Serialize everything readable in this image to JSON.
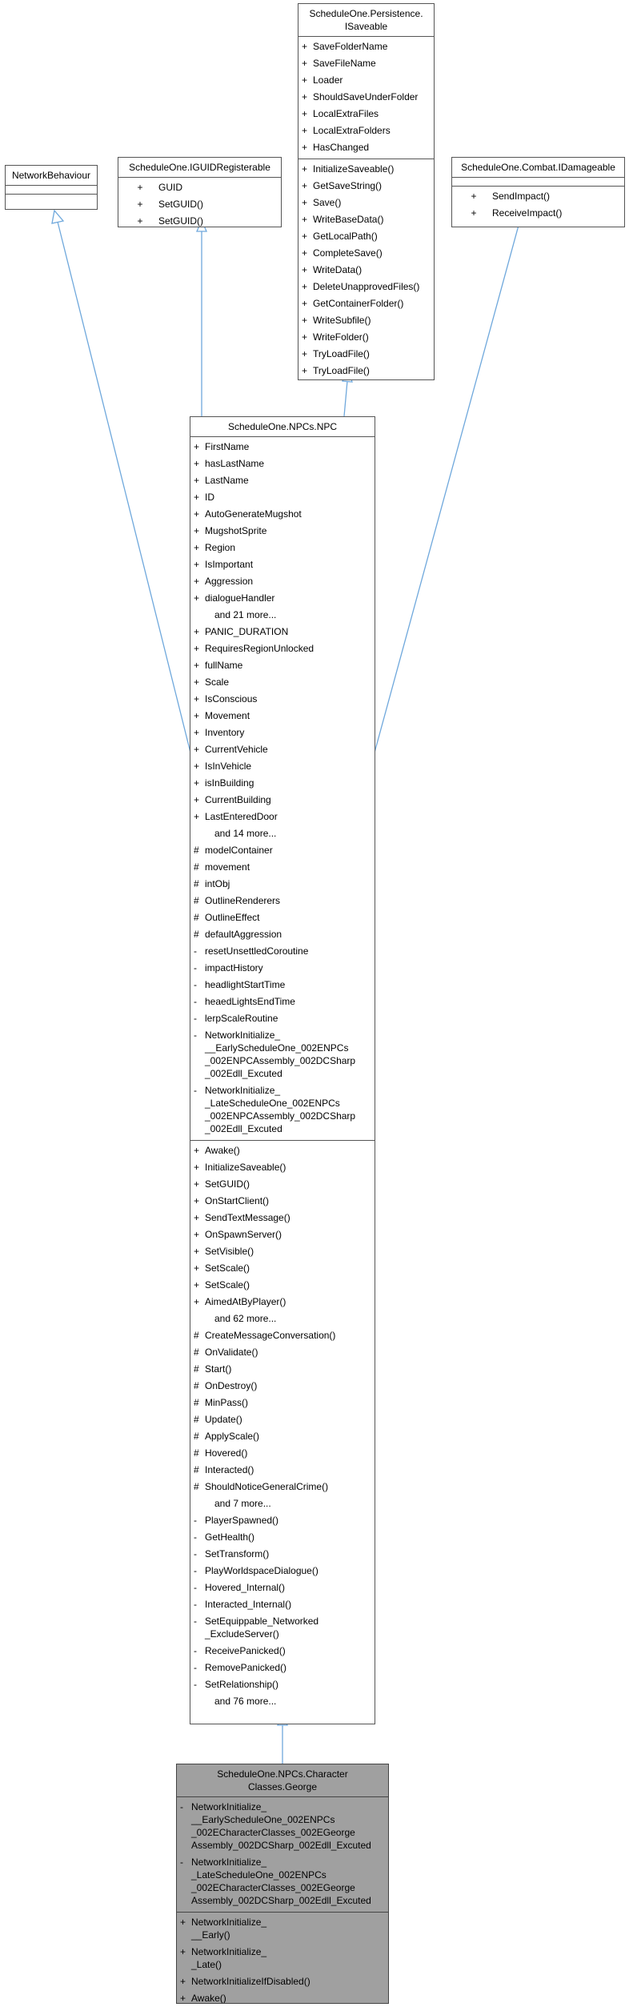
{
  "classes": {
    "network_behaviour": {
      "title": "NetworkBehaviour"
    },
    "iguid": {
      "title": "ScheduleOne.IGUIDRegisterable",
      "members": [
        {
          "v": "+",
          "n": "GUID"
        },
        {
          "v": "+",
          "n": "SetGUID()"
        },
        {
          "v": "+",
          "n": "SetGUID()"
        }
      ]
    },
    "isaveable": {
      "title": "ScheduleOne.Persistence.\nISaveable",
      "attrs": [
        {
          "v": "+",
          "n": "SaveFolderName"
        },
        {
          "v": "+",
          "n": "SaveFileName"
        },
        {
          "v": "+",
          "n": "Loader"
        },
        {
          "v": "+",
          "n": "ShouldSaveUnderFolder"
        },
        {
          "v": "+",
          "n": "LocalExtraFiles"
        },
        {
          "v": "+",
          "n": "LocalExtraFolders"
        },
        {
          "v": "+",
          "n": "HasChanged"
        }
      ],
      "methods": [
        {
          "v": "+",
          "n": "InitializeSaveable()"
        },
        {
          "v": "+",
          "n": "GetSaveString()"
        },
        {
          "v": "+",
          "n": "Save()"
        },
        {
          "v": "+",
          "n": "WriteBaseData()"
        },
        {
          "v": "+",
          "n": "GetLocalPath()"
        },
        {
          "v": "+",
          "n": "CompleteSave()"
        },
        {
          "v": "+",
          "n": "WriteData()"
        },
        {
          "v": "+",
          "n": "DeleteUnapprovedFiles()"
        },
        {
          "v": "+",
          "n": "GetContainerFolder()"
        },
        {
          "v": "+",
          "n": "WriteSubfile()"
        },
        {
          "v": "+",
          "n": "WriteFolder()"
        },
        {
          "v": "+",
          "n": "TryLoadFile()"
        },
        {
          "v": "+",
          "n": "TryLoadFile()"
        }
      ]
    },
    "idamageable": {
      "title": "ScheduleOne.Combat.IDamageable",
      "members": [
        {
          "v": "+",
          "n": "SendImpact()"
        },
        {
          "v": "+",
          "n": "ReceiveImpact()"
        }
      ]
    },
    "npc": {
      "title": "ScheduleOne.NPCs.NPC",
      "attrs": [
        {
          "v": "+",
          "n": "FirstName"
        },
        {
          "v": "+",
          "n": "hasLastName"
        },
        {
          "v": "+",
          "n": "LastName"
        },
        {
          "v": "+",
          "n": "ID"
        },
        {
          "v": "+",
          "n": "AutoGenerateMugshot"
        },
        {
          "v": "+",
          "n": "MugshotSprite"
        },
        {
          "v": "+",
          "n": "Region"
        },
        {
          "v": "+",
          "n": "IsImportant"
        },
        {
          "v": "+",
          "n": "Aggression"
        },
        {
          "v": "+",
          "n": "dialogueHandler"
        },
        {
          "v": "",
          "n": "and 21 more...",
          "more": true
        },
        {
          "v": "+",
          "n": "PANIC_DURATION"
        },
        {
          "v": "+",
          "n": "RequiresRegionUnlocked"
        },
        {
          "v": "+",
          "n": "fullName"
        },
        {
          "v": "+",
          "n": "Scale"
        },
        {
          "v": "+",
          "n": "IsConscious"
        },
        {
          "v": "+",
          "n": "Movement"
        },
        {
          "v": "+",
          "n": "Inventory"
        },
        {
          "v": "+",
          "n": "CurrentVehicle"
        },
        {
          "v": "+",
          "n": "IsInVehicle"
        },
        {
          "v": "+",
          "n": "isInBuilding"
        },
        {
          "v": "+",
          "n": "CurrentBuilding"
        },
        {
          "v": "+",
          "n": "LastEnteredDoor"
        },
        {
          "v": "",
          "n": "and 14 more...",
          "more": true
        },
        {
          "v": "#",
          "n": "modelContainer"
        },
        {
          "v": "#",
          "n": "movement"
        },
        {
          "v": "#",
          "n": "intObj"
        },
        {
          "v": "#",
          "n": "OutlineRenderers"
        },
        {
          "v": "#",
          "n": "OutlineEffect"
        },
        {
          "v": "#",
          "n": "defaultAggression"
        },
        {
          "v": "-",
          "n": "resetUnsettledCoroutine"
        },
        {
          "v": "-",
          "n": "impactHistory"
        },
        {
          "v": "-",
          "n": "headlightStartTime"
        },
        {
          "v": "-",
          "n": "heaedLightsEndTime"
        },
        {
          "v": "-",
          "n": "lerpScaleRoutine"
        },
        {
          "v": "-",
          "n": "NetworkInitialize_\n__EarlyScheduleOne_002ENPCs\n_002ENPCAssembly_002DCSharp\n_002Edll_Excuted"
        },
        {
          "v": "-",
          "n": "NetworkInitialize_\n_LateScheduleOne_002ENPCs\n_002ENPCAssembly_002DCSharp\n_002Edll_Excuted"
        }
      ],
      "methods": [
        {
          "v": "+",
          "n": "Awake()"
        },
        {
          "v": "+",
          "n": "InitializeSaveable()"
        },
        {
          "v": "+",
          "n": "SetGUID()"
        },
        {
          "v": "+",
          "n": "OnStartClient()"
        },
        {
          "v": "+",
          "n": "SendTextMessage()"
        },
        {
          "v": "+",
          "n": "OnSpawnServer()"
        },
        {
          "v": "+",
          "n": "SetVisible()"
        },
        {
          "v": "+",
          "n": "SetScale()"
        },
        {
          "v": "+",
          "n": "SetScale()"
        },
        {
          "v": "+",
          "n": "AimedAtByPlayer()"
        },
        {
          "v": "",
          "n": "and 62 more...",
          "more": true
        },
        {
          "v": "#",
          "n": "CreateMessageConversation()"
        },
        {
          "v": "#",
          "n": "OnValidate()"
        },
        {
          "v": "#",
          "n": "Start()"
        },
        {
          "v": "#",
          "n": "OnDestroy()"
        },
        {
          "v": "#",
          "n": "MinPass()"
        },
        {
          "v": "#",
          "n": "Update()"
        },
        {
          "v": "#",
          "n": "ApplyScale()"
        },
        {
          "v": "#",
          "n": "Hovered()"
        },
        {
          "v": "#",
          "n": "Interacted()"
        },
        {
          "v": "#",
          "n": "ShouldNoticeGeneralCrime()"
        },
        {
          "v": "",
          "n": "and 7 more...",
          "more": true
        },
        {
          "v": "-",
          "n": "PlayerSpawned()"
        },
        {
          "v": "-",
          "n": "GetHealth()"
        },
        {
          "v": "-",
          "n": "SetTransform()"
        },
        {
          "v": "-",
          "n": "PlayWorldspaceDialogue()"
        },
        {
          "v": "-",
          "n": "Hovered_Internal()"
        },
        {
          "v": "-",
          "n": "Interacted_Internal()"
        },
        {
          "v": "-",
          "n": "SetEquippable_Networked\n_ExcludeServer()"
        },
        {
          "v": "-",
          "n": "ReceivePanicked()"
        },
        {
          "v": "-",
          "n": "RemovePanicked()"
        },
        {
          "v": "-",
          "n": "SetRelationship()"
        },
        {
          "v": "",
          "n": "and 76 more...",
          "more": true
        }
      ]
    },
    "george": {
      "title": "ScheduleOne.NPCs.Character\nClasses.George",
      "attrs": [
        {
          "v": "-",
          "n": "NetworkInitialize_\n__EarlyScheduleOne_002ENPCs\n_002ECharacterClasses_002EGeorge\nAssembly_002DCSharp_002Edll_Excuted"
        },
        {
          "v": "-",
          "n": "NetworkInitialize_\n_LateScheduleOne_002ENPCs\n_002ECharacterClasses_002EGeorge\nAssembly_002DCSharp_002Edll_Excuted"
        }
      ],
      "methods": [
        {
          "v": "+",
          "n": "NetworkInitialize_\n__Early()"
        },
        {
          "v": "+",
          "n": "NetworkInitialize_\n_Late()"
        },
        {
          "v": "+",
          "n": "NetworkInitializeIfDisabled()"
        },
        {
          "v": "+",
          "n": "Awake()"
        }
      ]
    }
  }
}
